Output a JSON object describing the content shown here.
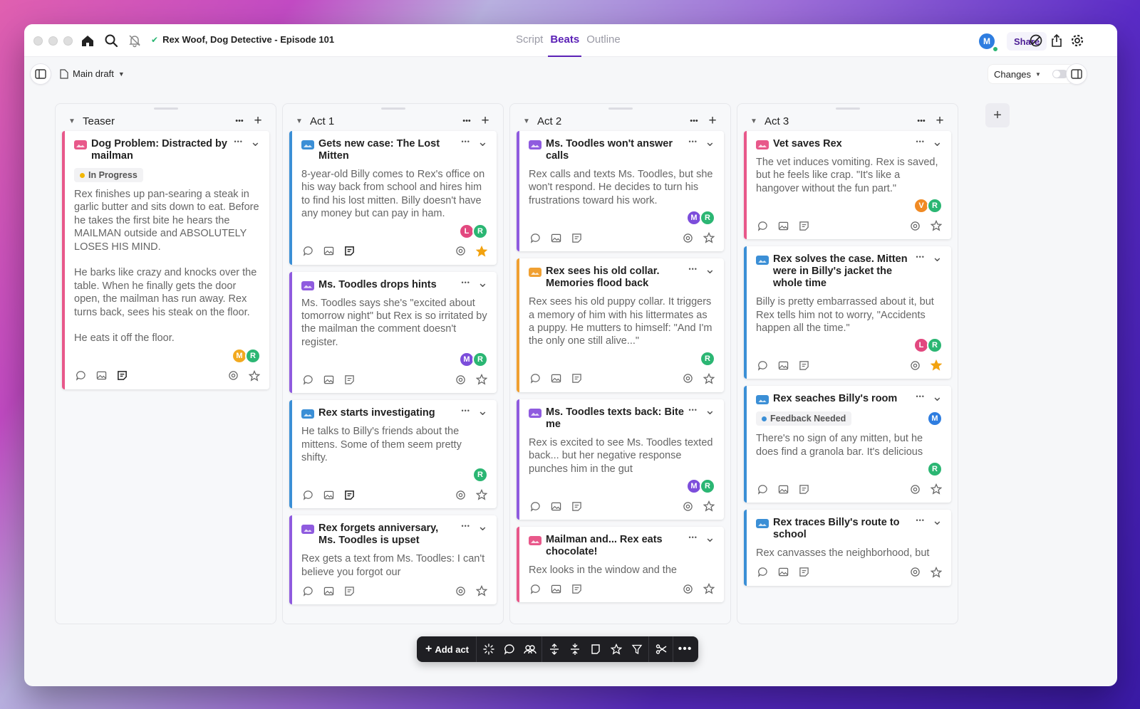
{
  "app": {
    "doc_title": "Rex Woof, Dog Detective - Episode 101",
    "tabs": [
      {
        "label": "Script",
        "active": false
      },
      {
        "label": "Beats",
        "active": true
      },
      {
        "label": "Outline",
        "active": false
      }
    ],
    "user_initial": "M",
    "share_label": "Share",
    "draft_label": "Main draft",
    "changes_label": "Changes"
  },
  "colors": {
    "pink": "#e8588a",
    "blue": "#3b8fd6",
    "purple": "#8f5bdf",
    "orange": "#f0a032",
    "accent": "#5b21b6",
    "avatar_M": "#7c4ddb",
    "avatar_R": "#2bb673",
    "avatar_L": "#e2487f",
    "avatar_V": "#f08a24",
    "avatar_Mo": "#f2a91f",
    "avatar_Mb": "#2e7de0"
  },
  "columns": [
    {
      "title": "Teaser",
      "cards": [
        {
          "title": "Dog Problem: Distracted by mailman",
          "color": "pink",
          "badge": {
            "text": "In Progress",
            "dot": "#f2b705"
          },
          "body": "Rex finishes up pan-searing a steak in garlic butter and sits down to eat. Before he takes the first bite he hears the MAILMAN outside and ABSOLUTELY LOSES HIS MIND.\n\nHe barks like crazy and knocks over the table. When he finally gets the door open, the mailman has run away.  Rex turns back, sees his steak on the floor.\n\nHe eats it off the floor.",
          "avatars": [
            {
              "i": "M",
              "c": "#f2a91f"
            },
            {
              "i": "R",
              "c": "#2bb673"
            }
          ],
          "starred": false,
          "note_filled": true
        }
      ]
    },
    {
      "title": "Act 1",
      "cards": [
        {
          "title": "Gets new case: The Lost Mitten",
          "color": "blue",
          "body": "8-year-old Billy comes to Rex's office on his way back from school and hires him to find his lost mitten. Billy doesn't have any money but can pay in ham.",
          "avatars": [
            {
              "i": "L",
              "c": "#e2487f"
            },
            {
              "i": "R",
              "c": "#2bb673"
            }
          ],
          "starred": true,
          "note_filled": true
        },
        {
          "title": "Ms. Toodles drops hints",
          "color": "purple",
          "body": "Ms. Toodles says she's \"excited about tomorrow night\" but Rex is so irritated by the mailman the comment doesn't register.",
          "avatars": [
            {
              "i": "M",
              "c": "#7c4ddb"
            },
            {
              "i": "R",
              "c": "#2bb673"
            }
          ],
          "starred": false,
          "note_filled": false
        },
        {
          "title": "Rex starts investigating",
          "color": "blue",
          "body": "He talks to Billy's friends about the mittens. Some of them seem pretty shifty.",
          "avatars": [
            {
              "i": "R",
              "c": "#2bb673"
            }
          ],
          "starred": false,
          "note_filled": true
        },
        {
          "title": "Rex forgets anniversary, Ms. Toodles is upset",
          "color": "purple",
          "body": "Rex gets a text from Ms. Toodles: I can't believe you forgot our",
          "avatars": [],
          "starred": false,
          "note_filled": false
        }
      ]
    },
    {
      "title": "Act 2",
      "cards": [
        {
          "title": "Ms. Toodles won't answer calls",
          "color": "purple",
          "body": "Rex calls and texts Ms. Toodles, but she won't respond. He decides to turn his frustrations toward his work.",
          "avatars": [
            {
              "i": "M",
              "c": "#7c4ddb"
            },
            {
              "i": "R",
              "c": "#2bb673"
            }
          ],
          "starred": false,
          "note_filled": false
        },
        {
          "title": "Rex sees his old collar. Memories flood back",
          "color": "orange",
          "body": "Rex sees his old puppy collar. It triggers a memory of him with his littermates as a puppy. He mutters to himself: \"And I'm the only one still alive...\"",
          "avatars": [
            {
              "i": "R",
              "c": "#2bb673"
            }
          ],
          "starred": false,
          "note_filled": false
        },
        {
          "title": "Ms. Toodles texts back: Bite me",
          "color": "purple",
          "body": "Rex is excited to see Ms. Toodles texted back... but her negative response punches him in the gut",
          "avatars": [
            {
              "i": "M",
              "c": "#7c4ddb"
            },
            {
              "i": "R",
              "c": "#2bb673"
            }
          ],
          "starred": false,
          "note_filled": false
        },
        {
          "title": "Mailman and... Rex eats chocolate!",
          "color": "pink",
          "body": "Rex looks in the window and the",
          "avatars": [],
          "starred": false,
          "note_filled": false
        }
      ]
    },
    {
      "title": "Act 3",
      "cards": [
        {
          "title": "Vet saves Rex",
          "color": "pink",
          "body": "The vet induces vomiting. Rex is saved, but he feels like crap. \"It's like a hangover without the fun part.\"",
          "avatars": [
            {
              "i": "V",
              "c": "#f08a24"
            },
            {
              "i": "R",
              "c": "#2bb673"
            }
          ],
          "starred": false,
          "note_filled": false
        },
        {
          "title": "Rex solves the case. Mitten were in Billy's jacket the whole time",
          "color": "blue",
          "body": "Billy is pretty embarrassed about it, but Rex tells him not to worry, \"Accidents happen all the time.\"",
          "avatars": [
            {
              "i": "L",
              "c": "#e2487f"
            },
            {
              "i": "R",
              "c": "#2bb673"
            }
          ],
          "starred": true,
          "note_filled": false
        },
        {
          "title": "Rex seaches Billy's room",
          "color": "blue",
          "badge": {
            "text": "Feedback Needed",
            "dot": "#3b8fd6"
          },
          "badge_avatar": {
            "i": "M",
            "c": "#2e7de0"
          },
          "body": "There's no sign of any mitten, but he does find a granola bar. It's delicious",
          "avatars": [
            {
              "i": "R",
              "c": "#2bb673"
            }
          ],
          "starred": false,
          "note_filled": false
        },
        {
          "title": "Rex traces Billy's route to school",
          "color": "blue",
          "body": "Rex canvasses the neighborhood, but",
          "avatars": [],
          "starred": false,
          "note_filled": false
        }
      ]
    }
  ],
  "bottom_bar": {
    "add_act_label": "Add act"
  }
}
